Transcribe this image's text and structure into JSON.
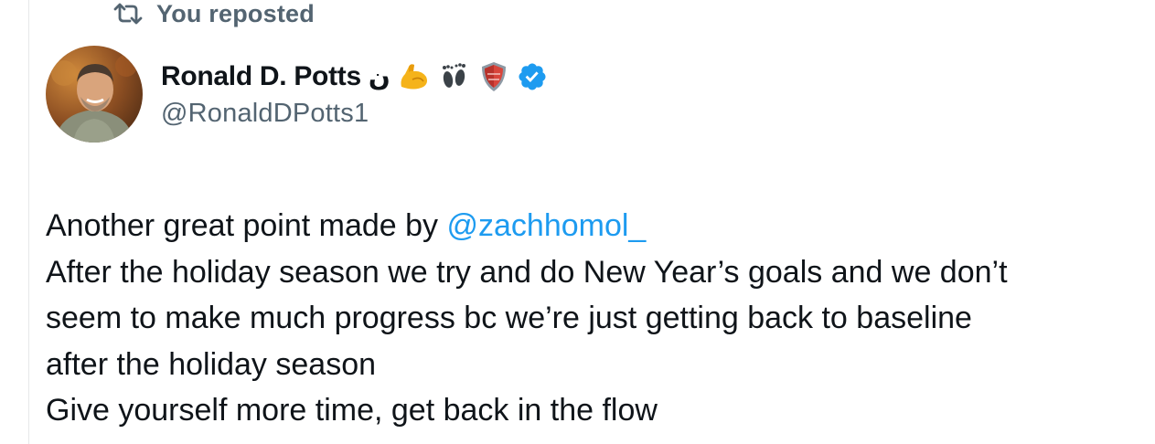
{
  "repost": {
    "icon": "repost-icon",
    "label": "You reposted"
  },
  "author": {
    "avatar": "profile-photo",
    "display_name": "Ronald D. Potts",
    "name_emoji": [
      "ن",
      "flexed-biceps-emoji",
      "footprints-emoji",
      "shield-emoji"
    ],
    "verified": true,
    "handle": "@RonaldDPotts1"
  },
  "tweet": {
    "line1_text": "Another great point made by ",
    "line1_mention": "@zachhomol_",
    "line2": "After the holiday season we try and do New Year’s goals and we don’t",
    "line3": "seem to make much progress bc we’re just getting back to baseline",
    "line4": "after the holiday season",
    "line5": "Give yourself more time, get back in the flow"
  },
  "colors": {
    "text": "#0f1419",
    "secondary": "#536471",
    "accent": "#1d9bf0",
    "verified": "#1d9bf0"
  }
}
